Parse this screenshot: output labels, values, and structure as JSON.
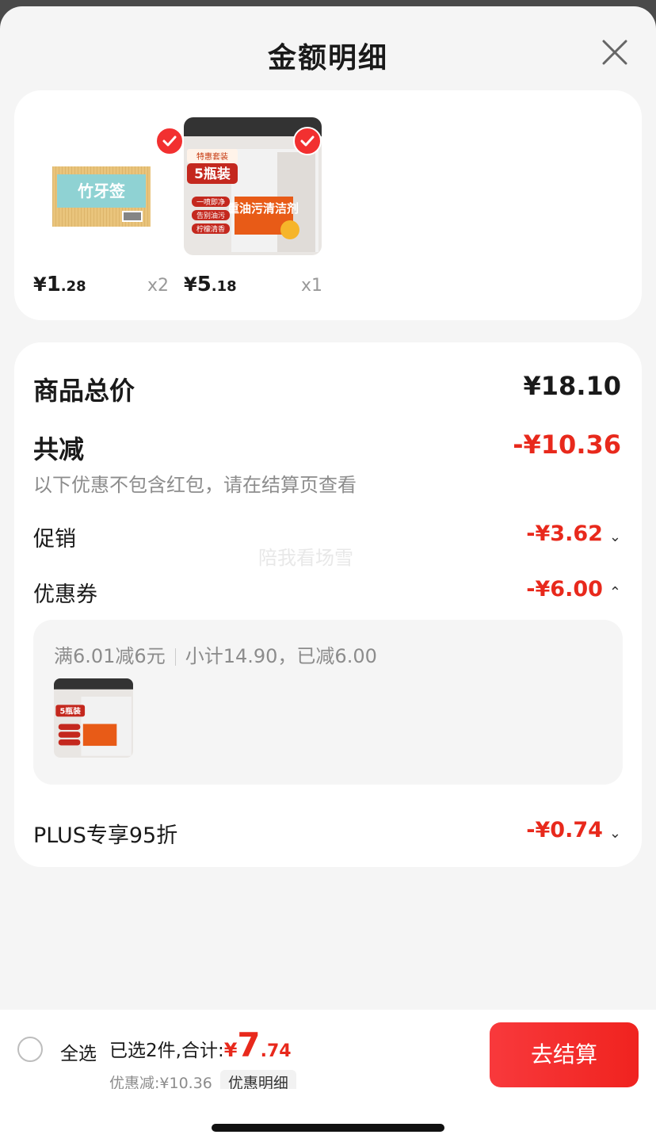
{
  "sheet": {
    "title": "金额明细"
  },
  "products": [
    {
      "name": "竹牙签",
      "price_int": "1",
      "price_dec": ".28",
      "currency": "¥",
      "qty": "x2"
    },
    {
      "name": "重油污清洁剂 5瓶装",
      "price_int": "5",
      "price_dec": ".18",
      "currency": "¥",
      "qty": "x1"
    }
  ],
  "product_img_text": {
    "toothpick_brand": "竹牙签",
    "cleaner_tag": "特惠套装",
    "cleaner_pack": "5瓶装",
    "cleaner_bullets": [
      "一喷即净",
      "告别油污",
      "柠檬清香"
    ],
    "cleaner_name": "重油污清洁剂"
  },
  "summary": {
    "total_label": "商品总价",
    "total_value": "¥18.10",
    "reduce_label": "共减",
    "reduce_value": "-¥10.36",
    "note": "以下优惠不包含红包，请在结算页查看",
    "promo_label": "促销",
    "promo_value": "-¥3.62",
    "coupon_label": "优惠券",
    "coupon_value": "-¥6.00",
    "coupon_rule": "满6.01减6元",
    "coupon_sub": "小计14.90，已减6.00",
    "plus_label": "PLUS专享95折",
    "plus_value": "-¥0.74"
  },
  "watermark": "陪我看场雪",
  "bottom_bar": {
    "select_all": "全选",
    "selected_text": "已选2件,合计:",
    "currency": "¥",
    "total_int": "7",
    "total_dec": ".74",
    "discount_text": "优惠减:¥10.36",
    "detail_button": "优惠明细",
    "checkout_button": "去结算"
  },
  "colors": {
    "accent": "#e8291c",
    "checkout": "#f52d2a",
    "background": "#f5f5f5"
  }
}
